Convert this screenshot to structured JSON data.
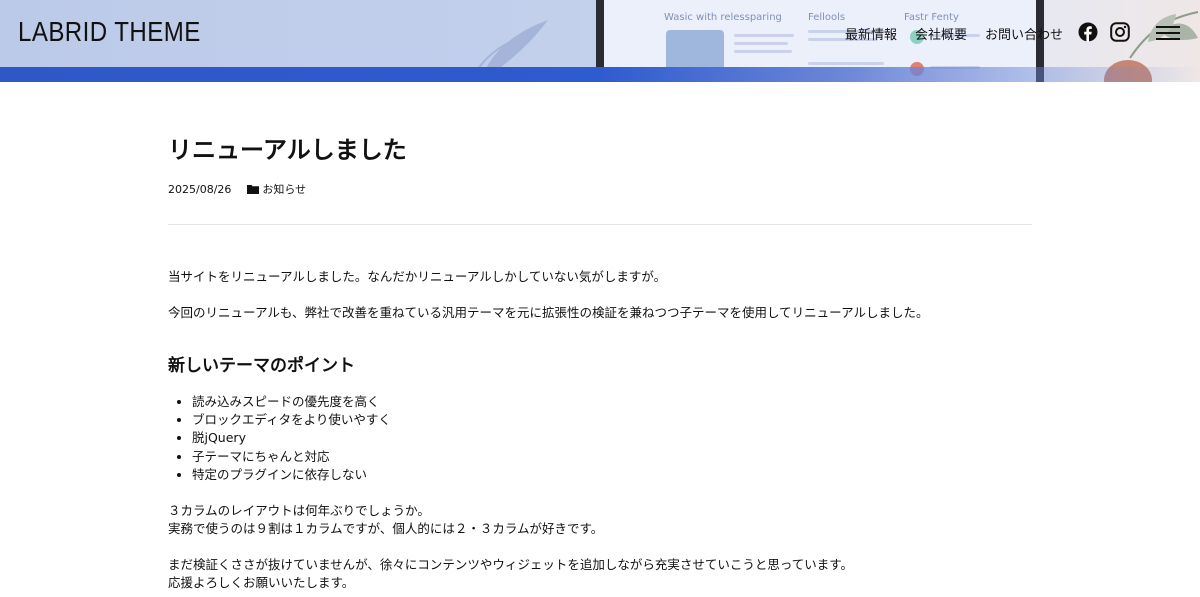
{
  "header": {
    "logo": "LABRID THEME",
    "nav": [
      {
        "label": "最新情報"
      },
      {
        "label": "会社概要"
      },
      {
        "label": "お問い合わせ"
      }
    ],
    "social": [
      {
        "icon": "facebook-icon"
      },
      {
        "icon": "instagram-icon"
      }
    ],
    "menu_icon": "hamburger-menu-icon",
    "hero_texts": [
      "Wasic with relessparing",
      "Fellools",
      "Fastr Fenty"
    ]
  },
  "article": {
    "title": "リニューアルしました",
    "date": "2025/08/26",
    "category": "お知らせ",
    "paragraphs": [
      "当サイトをリニューアルしました。なんだかリニューアルしかしていない気がしますが。",
      "今回のリニューアルも、弊社で改善を重ねている汎用テーマを元に拡張性の検証を兼ねつつ子テーマを使用してリニューアルしました。"
    ],
    "heading": "新しいテーマのポイント",
    "points": [
      "読み込みスピードの優先度を高く",
      "ブロックエディタをより使いやすく",
      "脱jQuery",
      "子テーマにちゃんと対応",
      "特定のプラグインに依存しない"
    ],
    "paragraph3_lines": [
      "３カラムのレイアウトは何年ぶりでしょうか。",
      "実務で使うのは９割は１カラムですが、個人的には２・３カラムが好きです。"
    ],
    "paragraph4_lines": [
      "まだ検証くささが抜けていませんが、徐々にコンテンツやウィジェットを追加しながら充実させていこうと思っています。",
      "応援よろしくお願いいたします。"
    ]
  },
  "colors": {
    "hero_blue": "#2f57c7",
    "hero_light": "#c3d0ec",
    "text": "#111111",
    "divider": "#e3e3e3"
  }
}
